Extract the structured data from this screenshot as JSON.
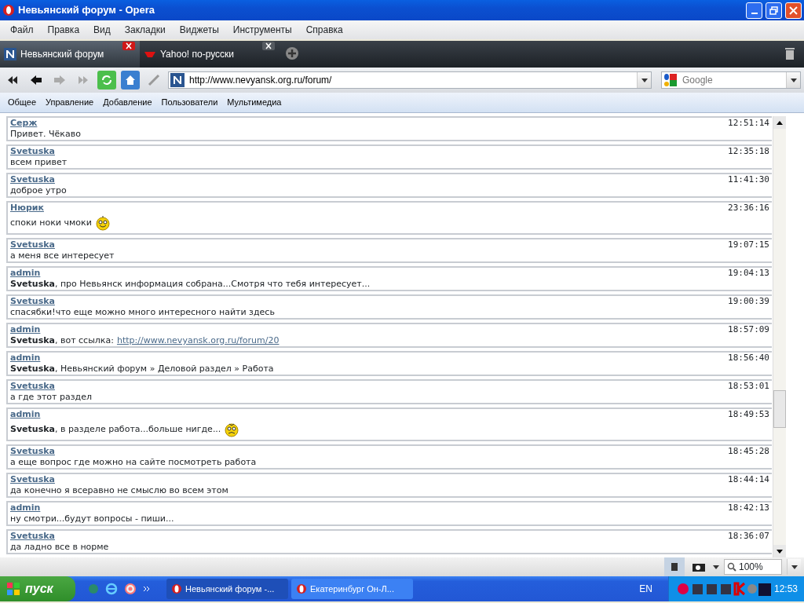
{
  "window": {
    "title": "Невьянский форум - Opera"
  },
  "menu": [
    "Файл",
    "Правка",
    "Вид",
    "Закладки",
    "Виджеты",
    "Инструменты",
    "Справка"
  ],
  "tabs": [
    {
      "label": "Невьянский форум",
      "selected": true
    },
    {
      "label": "Yahoo! по-русски",
      "selected": false
    }
  ],
  "address": {
    "value": "http://www.nevyansk.org.ru/forum/"
  },
  "search": {
    "placeholder": "Google"
  },
  "page_menu": [
    "Общее",
    "Управление",
    "Добавление",
    "Пользователи",
    "Мультимедиа"
  ],
  "messages": [
    {
      "author": "Серж",
      "time": "12:51:14",
      "text": "Привет. Чёкаво"
    },
    {
      "author": "Svetuska",
      "time": "12:35:18",
      "text": "всем привет"
    },
    {
      "author": "Svetuska",
      "time": "11:41:30",
      "text": "доброе утро"
    },
    {
      "author": "Нюрик",
      "time": "23:36:16",
      "text": "споки ноки чмоки",
      "kind": "smile"
    },
    {
      "author": "Svetuska",
      "time": "19:07:15",
      "text": "а меня все интересует"
    },
    {
      "author": "admin",
      "time": "19:04:13",
      "text": "**Svetuska**, про Невьянск информация собрана...Смотря что тебя интересует..."
    },
    {
      "author": "Svetuska",
      "time": "19:00:39",
      "text": "спасябки!что еще можно много интересного найти здесь"
    },
    {
      "author": "admin",
      "time": "18:57:09",
      "text": "**Svetuska**, вот ссылка:",
      "link": "http://www.nevyansk.org.ru/forum/20"
    },
    {
      "author": "admin",
      "time": "18:56:40",
      "text": "**Svetuska**, Невьянский форум » Деловой раздел » Работа"
    },
    {
      "author": "Svetuska",
      "time": "18:53:01",
      "text": "а где этот раздел"
    },
    {
      "author": "admin",
      "time": "18:49:53",
      "text": "**Svetuska**, в разделе работа...больше нигде...",
      "kind": "frown"
    },
    {
      "author": "Svetuska",
      "time": "18:45:28",
      "text": "а еще вопрос где можно на сайте посмотреть работа"
    },
    {
      "author": "Svetuska",
      "time": "18:44:14",
      "text": "да конечно я всеравно не смыслю во всем этом"
    },
    {
      "author": "admin",
      "time": "18:42:13",
      "text": "ну смотри...будут вопросы - пиши..."
    },
    {
      "author": "Svetuska",
      "time": "18:36:07",
      "text": "да ладно все в норме"
    }
  ],
  "status_bar": {
    "zoom": "100%"
  },
  "taskbar": {
    "start": "пуск",
    "tasks": [
      {
        "label": "Невьянский форум -...",
        "selected": true
      },
      {
        "label": "Екатеринбург Он-Л...",
        "selected": false
      }
    ],
    "language": "EN",
    "clock": "12:53"
  }
}
